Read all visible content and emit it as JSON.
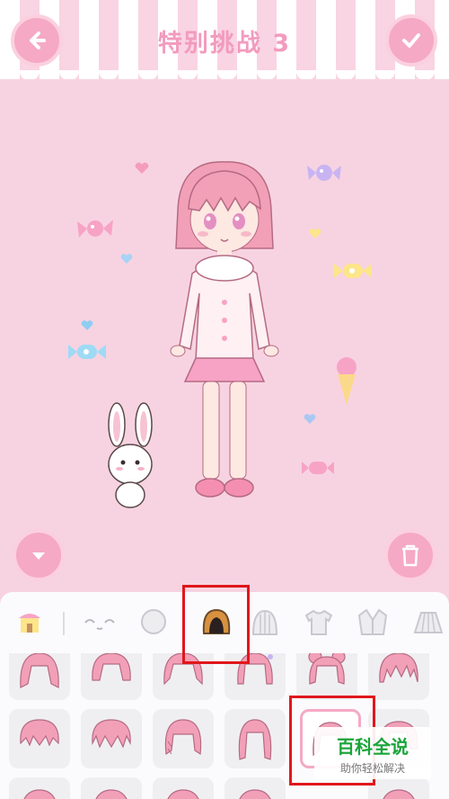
{
  "header": {
    "title": "特别挑战 3",
    "back_icon": "arrow-left-icon",
    "confirm_icon": "checkmark-icon"
  },
  "stage": {
    "collapse_icon": "chevron-down-icon",
    "trash_icon": "trash-icon"
  },
  "category_tabs": [
    {
      "icon": "shop-icon"
    },
    {
      "icon": "face-icon"
    },
    {
      "icon": "head-icon"
    },
    {
      "icon": "hair-icon",
      "selected": true
    },
    {
      "icon": "hat-icon"
    },
    {
      "icon": "shirt-icon"
    },
    {
      "icon": "jacket-icon"
    },
    {
      "icon": "skirt-icon"
    }
  ],
  "colors": {
    "accent_pink": "#f5a9c4",
    "title_pink": "#f29bbd",
    "hair_pink": "#f2a0b8",
    "highlight_red": "#e0171c"
  },
  "watermark": {
    "brand": "百科全说",
    "tagline": "助你轻松解决"
  }
}
